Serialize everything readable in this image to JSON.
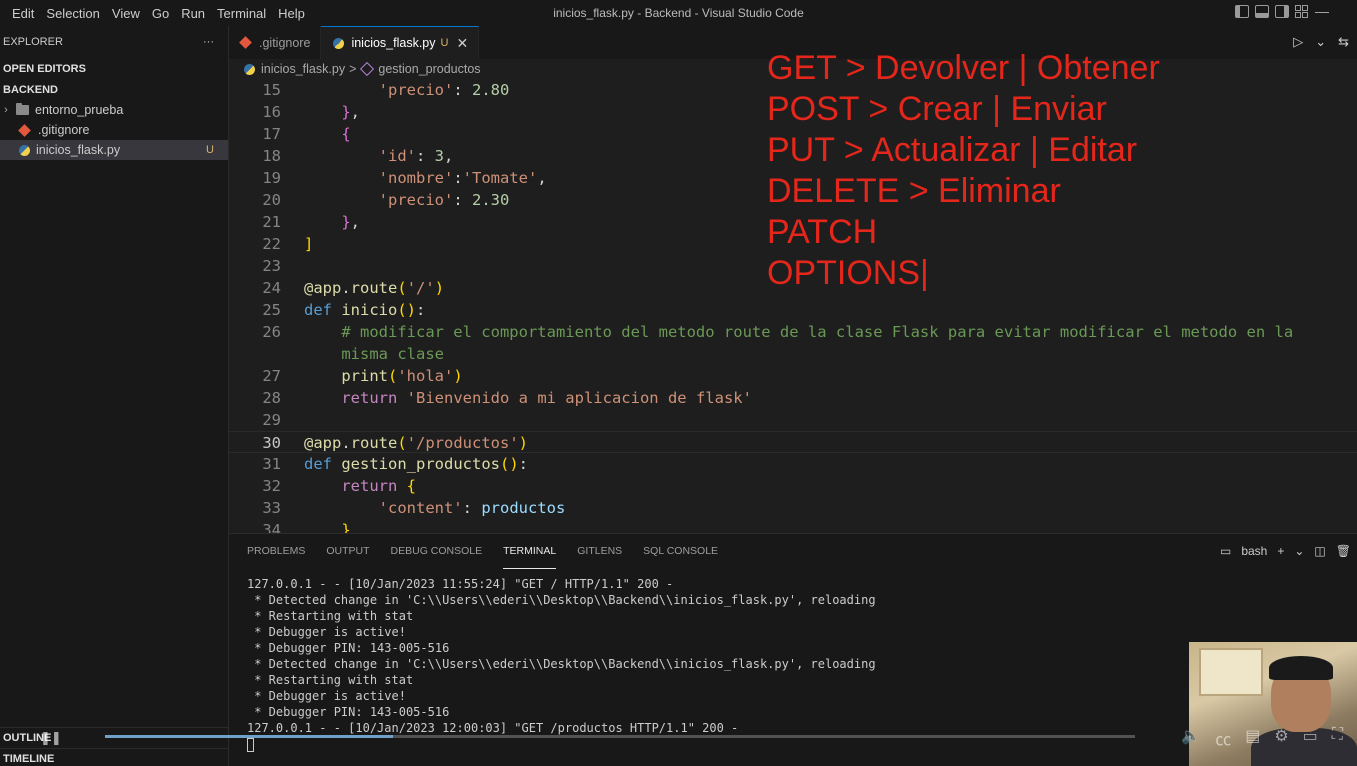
{
  "menu": [
    "Edit",
    "Selection",
    "View",
    "Go",
    "Run",
    "Terminal",
    "Help"
  ],
  "window_title": "inicios_flask.py - Backend - Visual Studio Code",
  "sidebar": {
    "title": "EXPLORER",
    "more": "···",
    "open_editors": "OPEN EDITORS",
    "folder": "BACKEND",
    "items": [
      {
        "label": "entorno_prueba",
        "icon": "folder-icon"
      },
      {
        "label": ".gitignore",
        "icon": "git-icon"
      },
      {
        "label": "inicios_flask.py",
        "icon": "python-icon",
        "badge": "U"
      }
    ],
    "outline": "OUTLINE",
    "timeline": "TIMELINE"
  },
  "tabs": [
    {
      "label": ".gitignore",
      "icon": "git-icon"
    },
    {
      "label": "inicios_flask.py",
      "icon": "python-icon",
      "badge": "U",
      "close": "✕"
    }
  ],
  "breadcrumb": {
    "file": "inicios_flask.py",
    "sep": ">",
    "symbol": "gestion_productos"
  },
  "code_lines": [
    {
      "n": "15"
    },
    {
      "n": "16"
    },
    {
      "n": "17"
    },
    {
      "n": "18"
    },
    {
      "n": "19"
    },
    {
      "n": "20"
    },
    {
      "n": "21"
    },
    {
      "n": "22"
    },
    {
      "n": "23"
    },
    {
      "n": "24"
    },
    {
      "n": "25"
    },
    {
      "n": "26"
    },
    {
      "n": ""
    },
    {
      "n": "27"
    },
    {
      "n": "28"
    },
    {
      "n": "29"
    },
    {
      "n": "30"
    },
    {
      "n": "31"
    },
    {
      "n": "32"
    },
    {
      "n": "33"
    },
    {
      "n": "34"
    }
  ],
  "notes": [
    "GET > Devolver | Obtener",
    "POST > Crear | Enviar",
    "PUT > Actualizar | Editar",
    "DELETE > Eliminar",
    "PATCH",
    "OPTIONS|"
  ],
  "panel": {
    "tabs": [
      "PROBLEMS",
      "OUTPUT",
      "DEBUG CONSOLE",
      "TERMINAL",
      "GITLENS",
      "SQL CONSOLE"
    ],
    "active_tab": "TERMINAL",
    "shell": "bash",
    "terminal_lines": [
      "127.0.0.1 - - [10/Jan/2023 11:55:24] \"GET / HTTP/1.1\" 200 -",
      " * Detected change in 'C:\\\\Users\\\\ederi\\\\Desktop\\\\Backend\\\\inicios_flask.py', reloading",
      " * Restarting with stat",
      " * Debugger is active!",
      " * Debugger PIN: 143-005-516",
      " * Detected change in 'C:\\\\Users\\\\ederi\\\\Desktop\\\\Backend\\\\inicios_flask.py', reloading",
      " * Restarting with stat",
      " * Debugger is active!",
      " * Debugger PIN: 143-005-516",
      "127.0.0.1 - - [10/Jan/2023 12:00:03] \"GET /productos HTTP/1.1\" 200 -"
    ]
  },
  "video": {
    "progress": 0.28
  }
}
